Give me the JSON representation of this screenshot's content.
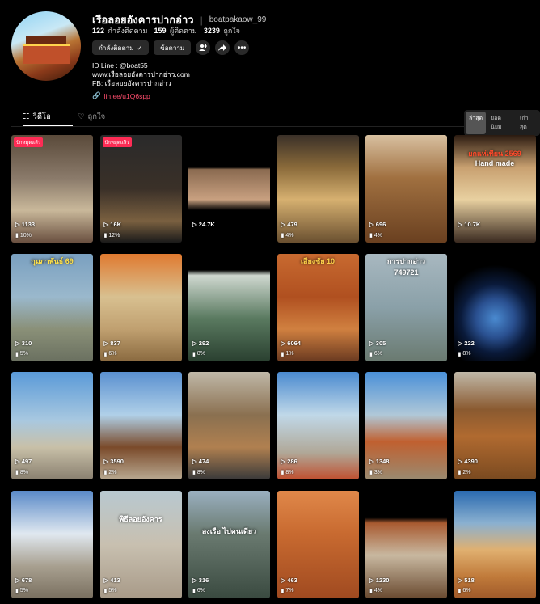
{
  "profile": {
    "name": "เรือลอยอังคารปากอ่าว",
    "handle": "boatpakaow_99",
    "following_count": "122",
    "following_label": "กำลังติดตาม",
    "followers_count": "159",
    "followers_label": "ผู้ติดตาม",
    "likes_count": "3239",
    "likes_label": "ถูกใจ",
    "following_button": "กำลังติดตาม",
    "message_button": "ข้อความ",
    "bio_line1": "ID Line : @boat55",
    "bio_line2": "www.เรือลอยอังคารปากอ่าว.com",
    "bio_line3": "FB: เรือลอยอังคารปากอ่าว",
    "link": "lin.ee/u1Q6spp"
  },
  "tabs": {
    "videos": "วิดีโอ",
    "liked": "ถูกใจ"
  },
  "sort": {
    "latest": "ล่าสุด",
    "popular": "ยอดนิยม",
    "oldest": "เก่าสุด"
  },
  "overlays": {
    "t6": "ยกแห่เทียน 2569",
    "t6b": "Hand made",
    "t8": "กุมภาพันธ์ 69",
    "t10": "เสียงชัย 10",
    "t11": "การปากอ่าว",
    "t11b": "749721",
    "t21": "พิธีลอยอังคาร",
    "t22": "ลงเรือ ไปคนเดียว"
  },
  "videos": [
    {
      "views": "1133",
      "pct": "10%",
      "badge": "ปักหมุดแล้ว"
    },
    {
      "views": "16K",
      "pct": "12%",
      "badge": "ปักหมุดแล้ว"
    },
    {
      "views": "24.7K",
      "pct": ""
    },
    {
      "views": "479",
      "pct": "4%"
    },
    {
      "views": "696",
      "pct": "4%"
    },
    {
      "views": "10.7K",
      "pct": ""
    },
    {
      "views": "310",
      "pct": "5%"
    },
    {
      "views": "837",
      "pct": "6%"
    },
    {
      "views": "292",
      "pct": "8%"
    },
    {
      "views": "6064",
      "pct": "1%"
    },
    {
      "views": "305",
      "pct": "6%"
    },
    {
      "views": "222",
      "pct": "8%"
    },
    {
      "views": "497",
      "pct": "8%"
    },
    {
      "views": "3590",
      "pct": "2%"
    },
    {
      "views": "474",
      "pct": "8%"
    },
    {
      "views": "286",
      "pct": "8%"
    },
    {
      "views": "1348",
      "pct": "3%"
    },
    {
      "views": "4390",
      "pct": "2%"
    },
    {
      "views": "678",
      "pct": "5%"
    },
    {
      "views": "413",
      "pct": "5%"
    },
    {
      "views": "316",
      "pct": "6%"
    },
    {
      "views": "463",
      "pct": "7%"
    },
    {
      "views": "1230",
      "pct": "4%"
    },
    {
      "views": "518",
      "pct": "6%"
    }
  ]
}
